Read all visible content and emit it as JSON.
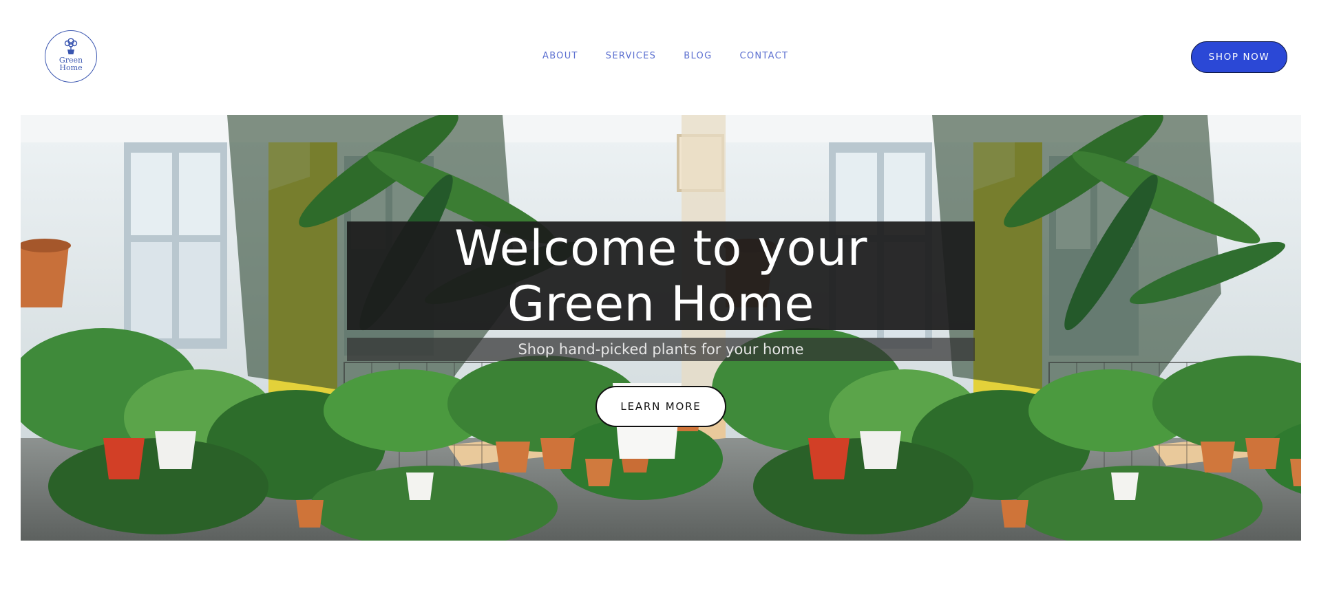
{
  "brand": {
    "line1": "Green",
    "line2": "Home",
    "icon": "potted-plant-icon"
  },
  "nav": {
    "items": [
      "ABOUT",
      "SERVICES",
      "BLOG",
      "CONTACT"
    ]
  },
  "header": {
    "cta_label": "SHOP NOW"
  },
  "hero": {
    "title_line1": "Welcome to your",
    "title_line2": "Green Home",
    "subtitle": "Shop hand-picked plants for your home",
    "cta_label": "LEARN MORE"
  },
  "colors": {
    "accent": "#2b48d6",
    "nav_text": "#5b6fd0",
    "logo": "#3a56b0",
    "title_band": "#1c1c1c",
    "wall_yellow": "#e3d13a",
    "foliage": "#2e6b2a",
    "terracotta": "#c8703a"
  }
}
